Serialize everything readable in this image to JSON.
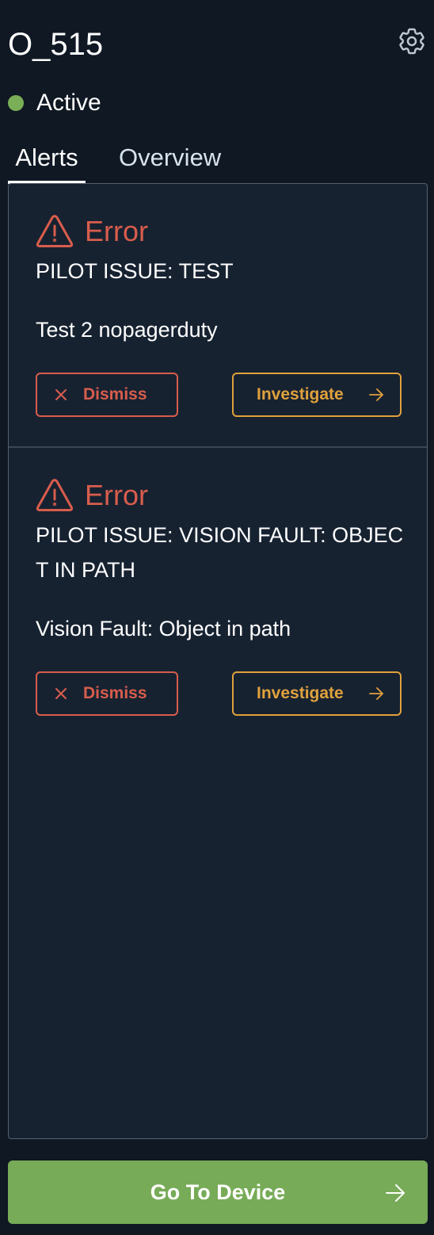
{
  "header": {
    "title": "O_515",
    "settings_icon": "gear-icon"
  },
  "status": {
    "label": "Active",
    "color": "#7aaf57"
  },
  "tabs": [
    {
      "label": "Alerts",
      "active": true
    },
    {
      "label": "Overview",
      "active": false
    }
  ],
  "alerts": [
    {
      "severity": "Error",
      "icon": "warning-triangle-icon",
      "title": "PILOT ISSUE: TEST",
      "description": "Test 2 nopagerduty",
      "dismiss_label": "Dismiss",
      "investigate_label": "Investigate"
    },
    {
      "severity": "Error",
      "icon": "warning-triangle-icon",
      "title": "PILOT ISSUE: VISION FAULT: OBJECT IN PATH",
      "description": "Vision Fault: Object in path",
      "dismiss_label": "Dismiss",
      "investigate_label": "Investigate"
    }
  ],
  "footer": {
    "button_label": "Go To Device",
    "icon": "arrow-right-icon"
  },
  "colors": {
    "background": "#0f1823",
    "panel": "#172231",
    "error": "#d85d4c",
    "warning": "#e0a13c",
    "primary": "#77ab57"
  }
}
